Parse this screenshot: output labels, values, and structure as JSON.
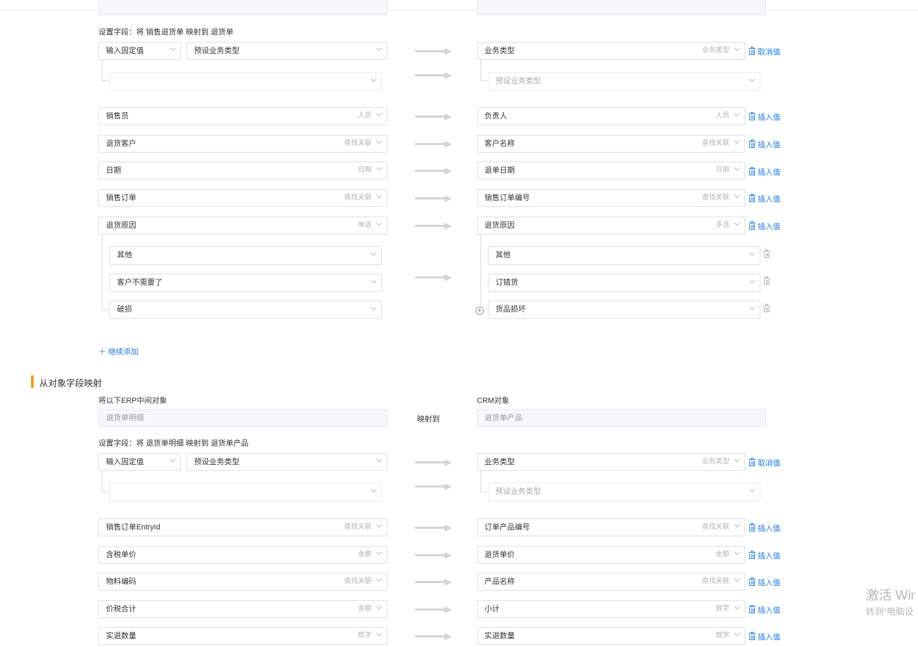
{
  "section1": {
    "top_left_value": "",
    "top_right_value": "",
    "set_fields_label": "设置字段：将 销售退货单 映射到 退货单",
    "fixed_row": {
      "mode_value": "输入固定值",
      "preset_value": "预设业务类型",
      "sub_empty_value": "",
      "target_name": "业务类型",
      "target_type": "业务类型",
      "sub_target_value": "预设业务类型",
      "action": "取消值"
    },
    "rows": [
      {
        "src": "销售员",
        "src_type": "人员",
        "dst": "负责人",
        "dst_type": "人员",
        "action": "插入值"
      },
      {
        "src": "退货客户",
        "src_type": "查找关联",
        "dst": "客户名称",
        "dst_type": "查找关联",
        "action": "插入值"
      },
      {
        "src": "日期",
        "src_type": "日期",
        "dst": "退单日期",
        "dst_type": "日期",
        "action": "插入值"
      },
      {
        "src": "销售订单",
        "src_type": "查找关联",
        "dst": "销售订单编号",
        "dst_type": "查找关联",
        "action": "插入值"
      },
      {
        "src": "退货原因",
        "src_type": "单选",
        "dst": "退货原因",
        "dst_type": "多选",
        "action": "插入值"
      }
    ],
    "option_pairs": [
      {
        "src": "其他",
        "dst": "其他"
      },
      {
        "src": "客户不需要了",
        "dst": "订错货"
      },
      {
        "src": "破损",
        "dst": "货品损坏"
      }
    ],
    "add_more": "继续添加"
  },
  "section2": {
    "title": "从对象字段映射",
    "erp_label": "将以下ERP中间对象",
    "crm_label": "CRM对象",
    "erp_value": "退货单明细",
    "map_to": "映射到",
    "crm_value": "退货单产品",
    "set_fields_label": "设置字段：将 退货单明细 映射到 退货单产品",
    "fixed_row": {
      "mode_value": "输入固定值",
      "preset_value": "预设业务类型",
      "sub_empty_value": "",
      "target_name": "业务类型",
      "target_type": "业务类型",
      "sub_target_value": "预设业务类型",
      "action": "取消值"
    },
    "rows": [
      {
        "src": "销售订单EntryId",
        "src_type": "查找关联",
        "dst": "订单产品编号",
        "dst_type": "查找关联",
        "action": "插入值"
      },
      {
        "src": "含税单价",
        "src_type": "金额",
        "dst": "退货单价",
        "dst_type": "金额",
        "action": "插入值"
      },
      {
        "src": "物料编码",
        "src_type": "查找关联",
        "dst": "产品名称",
        "dst_type": "查找关联",
        "action": "插入值"
      },
      {
        "src": "价税合计",
        "src_type": "金额",
        "dst": "小计",
        "dst_type": "数字",
        "action": "插入值"
      },
      {
        "src": "实退数量",
        "src_type": "数字",
        "dst": "实退数量",
        "dst_type": "数字",
        "action": "插入值"
      }
    ]
  },
  "watermark": {
    "line1": "激活 Wir",
    "line2": "转到“电脑设"
  },
  "colors": {
    "accent": "#1f7ce0",
    "section_bar": "#f39c12",
    "border": "#dcdfe6",
    "arrow": "#d4d4d4"
  },
  "icons": [
    "trash-icon",
    "chevron-down-icon",
    "arrow-right-icon",
    "plus-icon",
    "plus-circle-icon"
  ]
}
